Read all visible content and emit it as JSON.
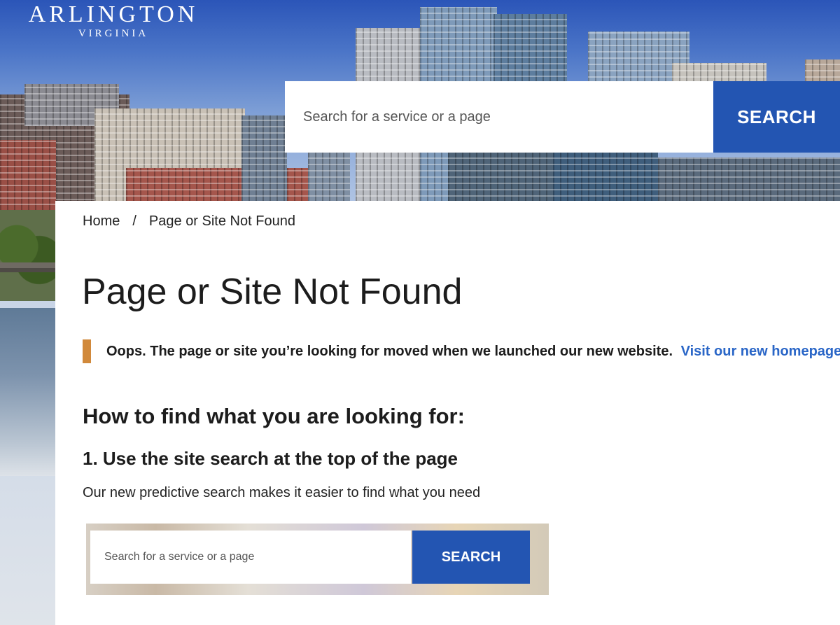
{
  "logo": {
    "main": "ARLINGTON",
    "sub": "VIRGINIA"
  },
  "header_search": {
    "placeholder": "Search for a service or a page",
    "button_label": "SEARCH"
  },
  "breadcrumb": {
    "home": "Home",
    "separator": "/",
    "current": "Page or Site Not Found"
  },
  "page_title": "Page or Site Not Found",
  "notice": {
    "message": "Oops. The page or site you’re looking for moved when we launched our new website.",
    "link_text": "Visit our new homepage."
  },
  "help": {
    "heading": "How to find what you are looking for:",
    "step1_heading": "1. Use the site search at the top of the page",
    "step1_text": "Our new predictive search makes it easier to find what you need"
  },
  "example_search": {
    "placeholder": "Search for a service or a page",
    "button_label": "SEARCH"
  },
  "colors": {
    "brand_blue": "#2355b2",
    "link_blue": "#2a66c7",
    "notice_accent": "#d1893b"
  }
}
